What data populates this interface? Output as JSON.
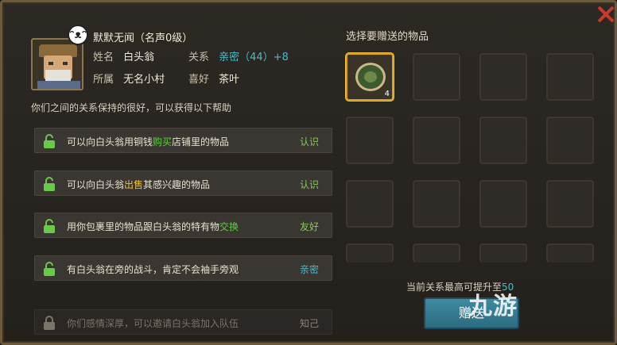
{
  "npc": {
    "title": "默默无闻（名声0级）",
    "name_label": "姓名",
    "name": "白头翁",
    "relation_label": "关系",
    "relation": "亲密（44）+8",
    "affiliation_label": "所属",
    "affiliation": "无名小村",
    "hobby_label": "喜好",
    "hobby": "茶叶",
    "emoji_icon": "grin-face-icon"
  },
  "description": "你们之间的关系保持的很好，可以获得以下帮助",
  "help_rows": [
    {
      "pre": "可以向白头翁用铜钱",
      "hl": "购买",
      "post": "店铺里的物品",
      "level": "认识"
    },
    {
      "pre": "可以向白头翁",
      "hl": "出售",
      "post": "其感兴趣的物品",
      "level": "认识"
    },
    {
      "pre": "用你包裹里的物品跟白头翁的特有物",
      "hl": "交换",
      "post": "",
      "level": "友好"
    },
    {
      "pre": "有白头翁在旁的战斗，肯定不会袖手旁观",
      "hl": "",
      "post": "",
      "level": "亲密"
    },
    {
      "pre": "你们感情深厚，可以邀请白头翁加入队伍",
      "hl": "",
      "post": "",
      "level": "知己"
    }
  ],
  "gift": {
    "title": "选择要赠送的物品",
    "item_count": "4",
    "upgrade_text": "当前关系最高可提升至",
    "upgrade_value": "50",
    "button_label": "赠送"
  },
  "watermark": "九游",
  "colors": {
    "teal": "#4fb8c8",
    "green": "#5ad23a",
    "gold": "#d8a020"
  }
}
